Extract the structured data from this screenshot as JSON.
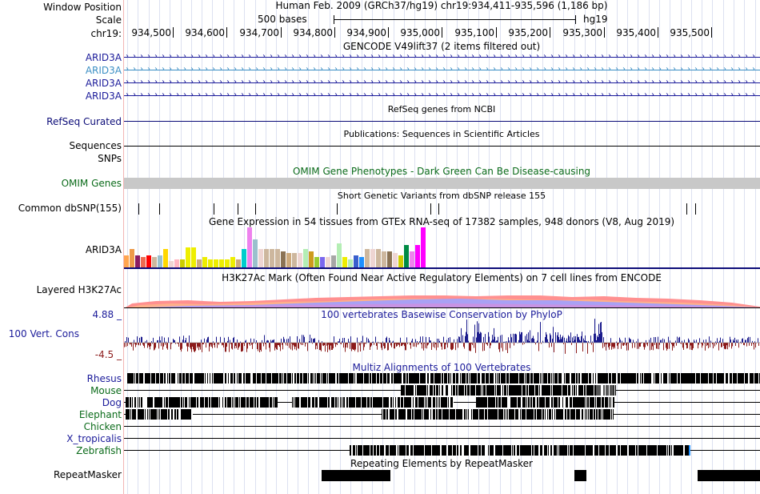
{
  "header": {
    "window_position_label": "Window Position",
    "scale_label": "Scale",
    "chrom_label": "chr19:",
    "assembly_info": "Human Feb. 2009 (GRCh37/hg19)    chr19:934,411-935,596 (1,186 bp)",
    "scale_text": "500 bases",
    "db_label": "hg19",
    "ruler_ticks": [
      "934,500",
      "934,600",
      "934,700",
      "934,800",
      "934,900",
      "935,000",
      "935,100",
      "935,200",
      "935,300",
      "935,400",
      "935,500"
    ]
  },
  "tracks": {
    "gencode": {
      "title": "GENCODE V49lift37 (2 items filtered out)",
      "items": [
        "ARID3A",
        "ARID3A",
        "ARID3A",
        "ARID3A"
      ],
      "colors": [
        "#1b1b9a",
        "#3c8fc4",
        "#1b1b9a",
        "#1b1b9a"
      ]
    },
    "refseq": {
      "title": "RefSeq genes from NCBI",
      "label": "RefSeq Curated",
      "color": "#0c0c78"
    },
    "publications": {
      "title": "Publications: Sequences in Scientific Articles",
      "label1": "Sequences",
      "label2": "SNPs"
    },
    "omim": {
      "title": "OMIM Gene Phenotypes - Dark Green Can Be Disease-causing",
      "label": "OMIM Genes",
      "color": "#0b6b1a",
      "bar_color": "#c8c8c8"
    },
    "dbsnp": {
      "title": "Short Genetic Variants from dbSNP release 155",
      "label": "Common dbSNP(155)"
    },
    "gtex": {
      "title": "Gene Expression in 54 tissues from GTEx RNA-seq of 17382 samples, 948 donors (V8, Aug 2019)",
      "label": "ARID3A",
      "expression_levels": [
        0.3,
        0.45,
        0.3,
        0.25,
        0.3,
        0.25,
        0.3,
        0.45,
        0.15,
        0.2,
        0.2,
        0.5,
        0.5,
        0.2,
        0.25,
        0.2,
        0.2,
        0.2,
        0.2,
        0.25,
        0.2,
        0.45,
        1.0,
        0.7,
        0.45,
        0.45,
        0.45,
        0.45,
        0.4,
        0.35,
        0.35,
        0.35,
        0.45,
        0.4,
        0.25,
        0.25,
        0.25,
        0.3,
        0.6,
        0.25,
        0.2,
        0.3,
        0.25,
        0.45,
        0.45,
        0.45,
        0.4,
        0.4,
        0.35,
        0.3,
        0.55,
        0.4,
        0.55,
        1.0
      ],
      "colors": [
        "#ffa54f",
        "#ee9a49",
        "#8b1c62",
        "#ee6a50",
        "#ff0000",
        "#cdb79e",
        "#9ac0cd",
        "#ffd700",
        "#eed5d2",
        "#ffb6c1",
        "#cdcd00",
        "#eeee00",
        "#eeee00",
        "#cdaa7d",
        "#eeee00",
        "#eeee00",
        "#eeee00",
        "#eeee00",
        "#eeee00",
        "#eeee00",
        "#cdaa7d",
        "#00cdcd",
        "#ee82ee",
        "#9ac0cd",
        "#eed5d2",
        "#cdb79e",
        "#cdb79e",
        "#cdb79e",
        "#8b7355",
        "#cdaa7d",
        "#cdb79e",
        "#eed5d2",
        "#b4eeb4",
        "#cd9b1d",
        "#9acd32",
        "#7a67ee",
        "#eed5d2",
        "#a6a6a6",
        "#b4eeb4",
        "#eeee00",
        "#b4eeb4",
        "#3a5fcd",
        "#1e90ff",
        "#cdb79e",
        "#eed5d2",
        "#cdb79e",
        "#cdb79e",
        "#8b7355",
        "#eed5d2",
        "#cdcd00",
        "#008b45",
        "#ee82ee",
        "#ff00ff",
        "#ff00ff"
      ]
    },
    "h3k27ac": {
      "title": "H3K27Ac Mark (Often Found Near Active Regulatory Elements) on 7 cell lines from ENCODE",
      "label": "Layered H3K27Ac",
      "colors": [
        "#ff8080",
        "#ffb080",
        "#d090ff",
        "#80a0ff",
        "#ff80c0"
      ]
    },
    "phylop": {
      "title": "100 vertebrates Basewise Conservation by PhyloP",
      "label": "100 Vert. Cons",
      "max_label": "4.88 _",
      "min_label": "-4.5 _",
      "pos_color": "#1a1a8c",
      "neg_color": "#8c1a1a"
    },
    "multiz": {
      "title": "Multiz Alignments of 100 Vertebrates",
      "species": [
        {
          "name": "Rhesus",
          "color": "#1b1b9a"
        },
        {
          "name": "Mouse",
          "color": "#0b6b1a"
        },
        {
          "name": "Dog",
          "color": "#1b1b9a"
        },
        {
          "name": "Elephant",
          "color": "#0b6b1a"
        },
        {
          "name": "Chicken",
          "color": "#0b6b1a"
        },
        {
          "name": "X_tropicalis",
          "color": "#1b1b9a"
        },
        {
          "name": "Zebrafish",
          "color": "#0b6b1a"
        }
      ]
    },
    "repeatmasker": {
      "title": "Repeating Elements by RepeatMasker",
      "label": "RepeatMasker"
    }
  }
}
